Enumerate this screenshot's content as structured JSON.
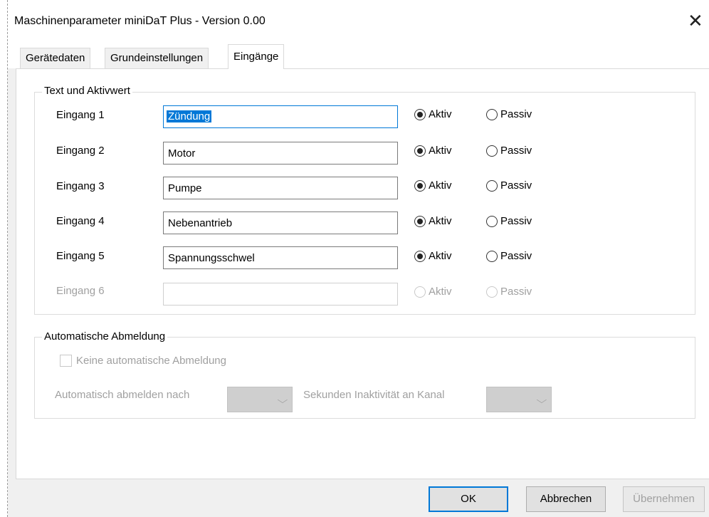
{
  "window": {
    "title": "Maschinenparameter miniDaT Plus - Version 0.00",
    "close_glyph": "✕"
  },
  "tabs": [
    {
      "label": "Gerätedaten",
      "active": false
    },
    {
      "label": "Grundeinstellungen",
      "active": false
    },
    {
      "label": "Eingänge",
      "active": true
    }
  ],
  "inputs_group": {
    "legend": "Text und Aktivwert",
    "active_label": "Aktiv",
    "passive_label": "Passiv",
    "rows": [
      {
        "label": "Eingang 1",
        "value": "Zündung",
        "selected": "Aktiv",
        "enabled": true
      },
      {
        "label": "Eingang 2",
        "value": "Motor",
        "selected": "Aktiv",
        "enabled": true
      },
      {
        "label": "Eingang 3",
        "value": "Pumpe",
        "selected": "Aktiv",
        "enabled": true
      },
      {
        "label": "Eingang 4",
        "value": "Nebenantrieb",
        "selected": "Aktiv",
        "enabled": true
      },
      {
        "label": "Eingang 5",
        "value": "Spannungsschwel",
        "selected": "Aktiv",
        "enabled": true
      },
      {
        "label": "Eingang 6",
        "value": "",
        "selected": "",
        "enabled": false
      }
    ]
  },
  "auto_logout": {
    "legend": "Automatische Abmeldung",
    "checkbox_label": "Keine automatische Abmeldung",
    "checked": false,
    "after_label": "Automatisch abmelden nach",
    "seconds_label": "Sekunden Inaktivität an Kanal",
    "seconds_value": "",
    "channel_value": ""
  },
  "buttons": {
    "ok": "OK",
    "cancel": "Abbrechen",
    "apply": "Übernehmen"
  },
  "colors": {
    "focus": "#0078d7",
    "disabled_text": "#a0a0a0",
    "dialog_bg": "#f0f0f0"
  }
}
